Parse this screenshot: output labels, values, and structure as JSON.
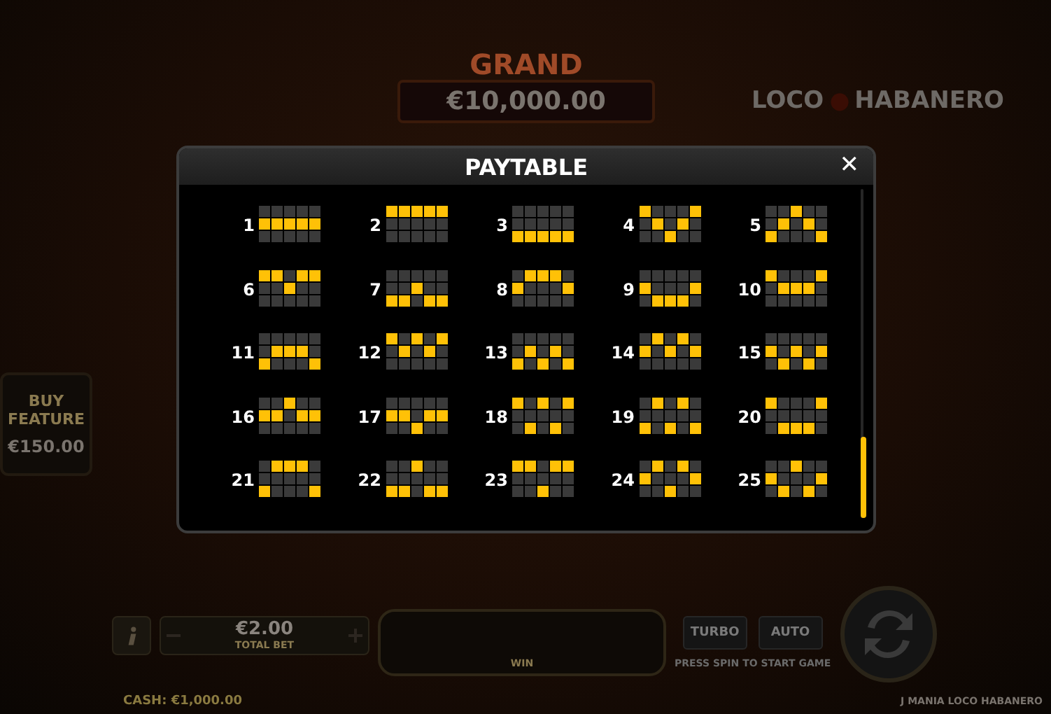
{
  "jackpot": {
    "label": "GRAND",
    "value": "€10,000.00"
  },
  "logo": {
    "word_1": "LOCO",
    "word_2": "HABANERO"
  },
  "buy_feature": {
    "label": "BUY FEATURE",
    "price": "€150.00"
  },
  "controls": {
    "bet": "€2.00",
    "bet_label": "TOTAL BET",
    "win_label": "WIN",
    "turbo": "TURBO",
    "auto": "AUTO",
    "hint": "PRESS SPIN TO START GAME"
  },
  "status_bar": {
    "cash": "CASH: €1,000.00",
    "game": "J MANIA LOCO HABANERO"
  },
  "paytable": {
    "title": "PAYTABLE",
    "close": "✕",
    "paylines": [
      {
        "number": "1",
        "lit": [
          [
            false,
            false,
            false,
            false,
            false
          ],
          [
            true,
            true,
            true,
            true,
            true
          ],
          [
            false,
            false,
            false,
            false,
            false
          ]
        ]
      },
      {
        "number": "2",
        "lit": [
          [
            true,
            true,
            true,
            true,
            true
          ],
          [
            false,
            false,
            false,
            false,
            false
          ],
          [
            false,
            false,
            false,
            false,
            false
          ]
        ]
      },
      {
        "number": "3",
        "lit": [
          [
            false,
            false,
            false,
            false,
            false
          ],
          [
            false,
            false,
            false,
            false,
            false
          ],
          [
            true,
            true,
            true,
            true,
            true
          ]
        ]
      },
      {
        "number": "4",
        "lit": [
          [
            true,
            false,
            false,
            false,
            true
          ],
          [
            false,
            true,
            false,
            true,
            false
          ],
          [
            false,
            false,
            true,
            false,
            false
          ]
        ]
      },
      {
        "number": "5",
        "lit": [
          [
            false,
            false,
            true,
            false,
            false
          ],
          [
            false,
            true,
            false,
            true,
            false
          ],
          [
            true,
            false,
            false,
            false,
            true
          ]
        ]
      },
      {
        "number": "6",
        "lit": [
          [
            true,
            true,
            false,
            true,
            true
          ],
          [
            false,
            false,
            true,
            false,
            false
          ],
          [
            false,
            false,
            false,
            false,
            false
          ]
        ]
      },
      {
        "number": "7",
        "lit": [
          [
            false,
            false,
            false,
            false,
            false
          ],
          [
            false,
            false,
            true,
            false,
            false
          ],
          [
            true,
            true,
            false,
            true,
            true
          ]
        ]
      },
      {
        "number": "8",
        "lit": [
          [
            false,
            true,
            true,
            true,
            false
          ],
          [
            true,
            false,
            false,
            false,
            true
          ],
          [
            false,
            false,
            false,
            false,
            false
          ]
        ]
      },
      {
        "number": "9",
        "lit": [
          [
            false,
            false,
            false,
            false,
            false
          ],
          [
            true,
            false,
            false,
            false,
            true
          ],
          [
            false,
            true,
            true,
            true,
            false
          ]
        ]
      },
      {
        "number": "10",
        "lit": [
          [
            true,
            false,
            false,
            false,
            true
          ],
          [
            false,
            true,
            true,
            true,
            false
          ],
          [
            false,
            false,
            false,
            false,
            false
          ]
        ]
      },
      {
        "number": "11",
        "lit": [
          [
            false,
            false,
            false,
            false,
            false
          ],
          [
            false,
            true,
            true,
            true,
            false
          ],
          [
            true,
            false,
            false,
            false,
            true
          ]
        ]
      },
      {
        "number": "12",
        "lit": [
          [
            true,
            false,
            true,
            false,
            true
          ],
          [
            false,
            true,
            false,
            true,
            false
          ],
          [
            false,
            false,
            false,
            false,
            false
          ]
        ]
      },
      {
        "number": "13",
        "lit": [
          [
            false,
            false,
            false,
            false,
            false
          ],
          [
            false,
            true,
            false,
            true,
            false
          ],
          [
            true,
            false,
            true,
            false,
            true
          ]
        ]
      },
      {
        "number": "14",
        "lit": [
          [
            false,
            true,
            false,
            true,
            false
          ],
          [
            true,
            false,
            true,
            false,
            true
          ],
          [
            false,
            false,
            false,
            false,
            false
          ]
        ]
      },
      {
        "number": "15",
        "lit": [
          [
            false,
            false,
            false,
            false,
            false
          ],
          [
            true,
            false,
            true,
            false,
            true
          ],
          [
            false,
            true,
            false,
            true,
            false
          ]
        ]
      },
      {
        "number": "16",
        "lit": [
          [
            false,
            false,
            true,
            false,
            false
          ],
          [
            true,
            true,
            false,
            true,
            true
          ],
          [
            false,
            false,
            false,
            false,
            false
          ]
        ]
      },
      {
        "number": "17",
        "lit": [
          [
            false,
            false,
            false,
            false,
            false
          ],
          [
            true,
            true,
            false,
            true,
            true
          ],
          [
            false,
            false,
            true,
            false,
            false
          ]
        ]
      },
      {
        "number": "18",
        "lit": [
          [
            true,
            false,
            true,
            false,
            true
          ],
          [
            false,
            false,
            false,
            false,
            false
          ],
          [
            false,
            true,
            false,
            true,
            false
          ]
        ]
      },
      {
        "number": "19",
        "lit": [
          [
            false,
            true,
            false,
            true,
            false
          ],
          [
            false,
            false,
            false,
            false,
            false
          ],
          [
            true,
            false,
            true,
            false,
            true
          ]
        ]
      },
      {
        "number": "20",
        "lit": [
          [
            true,
            false,
            false,
            false,
            true
          ],
          [
            false,
            false,
            false,
            false,
            false
          ],
          [
            false,
            true,
            true,
            true,
            false
          ]
        ]
      },
      {
        "number": "21",
        "lit": [
          [
            false,
            true,
            true,
            true,
            false
          ],
          [
            false,
            false,
            false,
            false,
            false
          ],
          [
            true,
            false,
            false,
            false,
            true
          ]
        ]
      },
      {
        "number": "22",
        "lit": [
          [
            false,
            false,
            true,
            false,
            false
          ],
          [
            false,
            false,
            false,
            false,
            false
          ],
          [
            true,
            true,
            false,
            true,
            true
          ]
        ]
      },
      {
        "number": "23",
        "lit": [
          [
            true,
            true,
            false,
            true,
            true
          ],
          [
            false,
            false,
            false,
            false,
            false
          ],
          [
            false,
            false,
            true,
            false,
            false
          ]
        ]
      },
      {
        "number": "24",
        "lit": [
          [
            false,
            true,
            false,
            true,
            false
          ],
          [
            true,
            false,
            false,
            false,
            true
          ],
          [
            false,
            false,
            true,
            false,
            false
          ]
        ]
      },
      {
        "number": "25",
        "lit": [
          [
            false,
            false,
            true,
            false,
            false
          ],
          [
            true,
            false,
            false,
            false,
            true
          ],
          [
            false,
            true,
            false,
            true,
            false
          ]
        ]
      }
    ]
  }
}
